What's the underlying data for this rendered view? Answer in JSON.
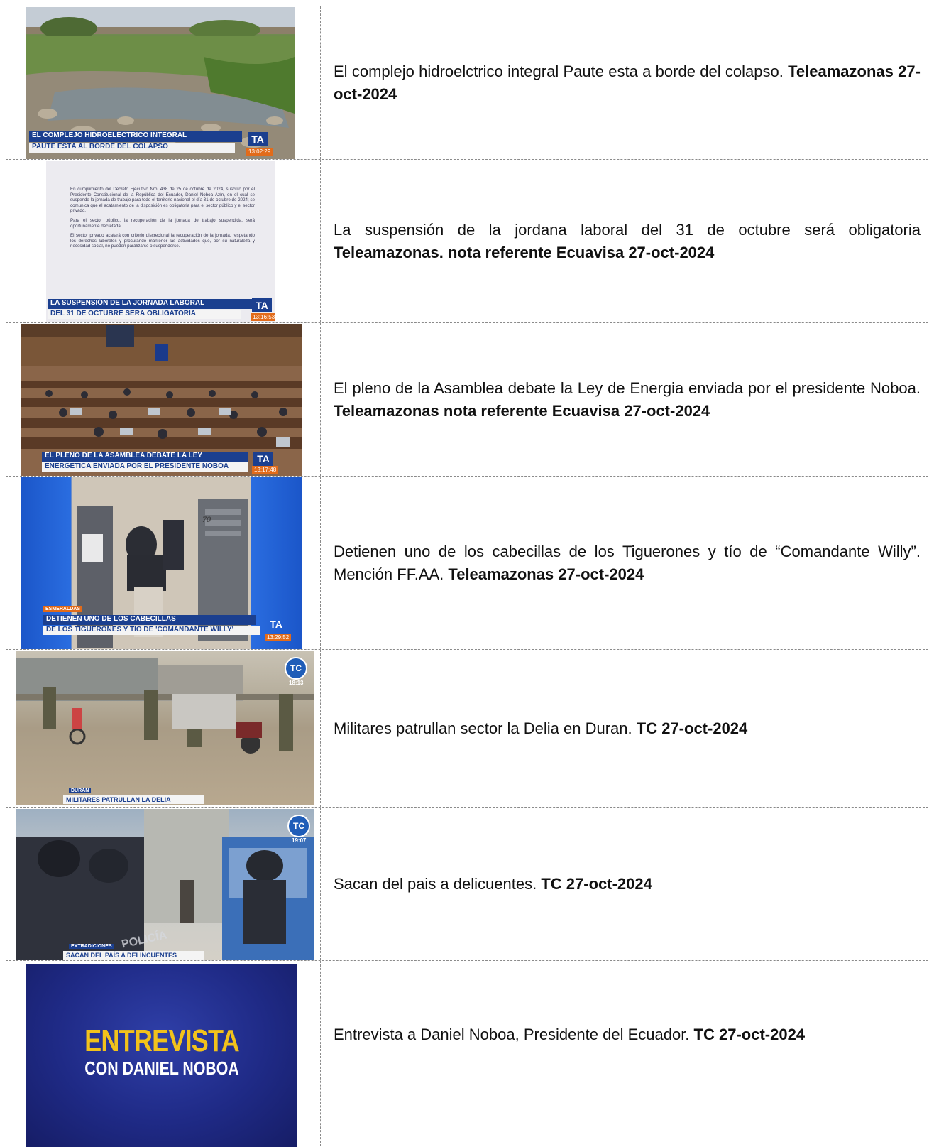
{
  "rows": [
    {
      "thumb": {
        "lower_third_line1": "EL COMPLEJO HIDROELÉCTRICO INTEGRAL",
        "lower_third_line2": "PAUTE ESTÁ AL BORDE DEL COLAPSO",
        "logo": "TA",
        "time": "13:02:29"
      },
      "text": "El complejo hidroelctrico integral Paute esta a borde del colapso.",
      "source": "Teleamazonas   27-oct-2024"
    },
    {
      "thumb": {
        "body_p1": "En cumplimiento del Decreto Ejecutivo Nro. 438 de 25 de octubre de 2024, suscrito por el Presidente Constitucional de la República del Ecuador, Daniel Noboa Azín, en el cual se suspende la jornada de trabajo para todo el territorio nacional el día 31 de octubre de 2024; se comunica que el acatamiento de la disposición es obligatoria para el sector público y el sector privado.",
        "body_p2": "Para el sector público, la recuperación de la jornada de trabajo suspendida, será oportunamente decretada.",
        "body_p3": "El sector privado acatará con criterio discrecional la recuperación de la jornada, respetando los derechos laborales y procurando mantener las actividades que, por su naturaleza y necesidad social, no pueden paralizarse o suspenderse.",
        "lower_third_line1": "LA SUSPENSIÓN DE LA JORNADA LABORAL",
        "lower_third_line2": "DEL 31 DE OCTUBRE SERÁ OBLIGATORIA",
        "logo": "TA",
        "time": "13:16:53"
      },
      "text": "La suspensión de la jordana laboral del 31 de octubre será obligatoria",
      "source": "Teleamazonas. nota referente Ecuavisa 27-oct-2024"
    },
    {
      "thumb": {
        "lower_third_line1": "EL PLENO DE LA ASAMBLEA DEBATE LA LEY",
        "lower_third_line2": "ENERGÉTICA ENVIADA POR EL PRESIDENTE NOBOA",
        "logo": "TA",
        "time": "13:17:48"
      },
      "text": "El pleno de la Asamblea debate la Ley de Energia enviada por el presidente Noboa.",
      "source": "Teleamazonas nota referente Ecuavisa  27-oct-2024"
    },
    {
      "thumb": {
        "tag": "ESMERALDAS",
        "lower_third_line1": "DETIENEN UNO DE LOS CABECILLAS",
        "lower_third_line2": "DE LOS TIGUERONES Y TÍO DE 'COMANDANTE WILLY'",
        "door_number": "70",
        "logo": "TA",
        "time": "13:29:52"
      },
      "text": "Detienen uno de los cabecillas de los Tiguerones y tío de “Comandante Willy”. Mención FF.AA.",
      "source": "Teleamazonas  27-oct-2024"
    },
    {
      "thumb": {
        "tag": "DURÁN",
        "lower_third": "MILITARES PATRULLAN LA DELIA",
        "logo": "TC",
        "time": "18:13"
      },
      "text": "Militares patrullan sector la Delia en Duran.",
      "source": "TC  27-oct-2024"
    },
    {
      "thumb": {
        "tag": "EXTRADICIONES",
        "lower_third": "SACAN DEL PAÍS A DELINCUENTES",
        "logo": "TC",
        "time": "19:07",
        "vehicle_text": "POLICÍA"
      },
      "text": "Sacan del pais a delicuentes.",
      "source": "TC  27-oct-2024"
    },
    {
      "thumb": {
        "title": "ENTREVISTA",
        "subtitle": "CON DANIEL NOBOA"
      },
      "text": "Entrevista a Daniel Noboa, Presidente del Ecuador.",
      "source": "TC 27-oct-2024"
    }
  ]
}
